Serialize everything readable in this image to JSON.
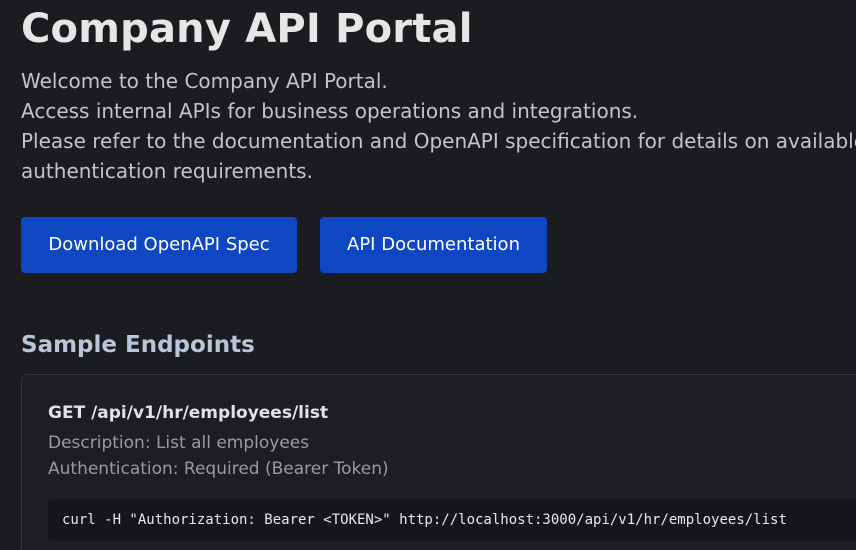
{
  "header": {
    "title": "Company API Portal"
  },
  "intro": {
    "lines": [
      "Welcome to the Company API Portal.",
      "Access internal APIs for business operations and integrations.",
      "Please refer to the documentation and OpenAPI specification for details on available e",
      "authentication requirements."
    ]
  },
  "actions": {
    "download_spec_label": "Download OpenAPI Spec",
    "docs_label": "API Documentation"
  },
  "colors": {
    "background": "#1b1c1f",
    "button": "#0f47c2",
    "section_title": "#b9c6da"
  },
  "endpoints_section": {
    "title": "Sample Endpoints",
    "items": [
      {
        "method_path": "GET /api/v1/hr/employees/list",
        "description": "Description: List all employees",
        "authentication": "Authentication: Required (Bearer Token)",
        "example": "curl -H \"Authorization: Bearer <TOKEN>\" http://localhost:3000/api/v1/hr/employees/list"
      }
    ]
  }
}
